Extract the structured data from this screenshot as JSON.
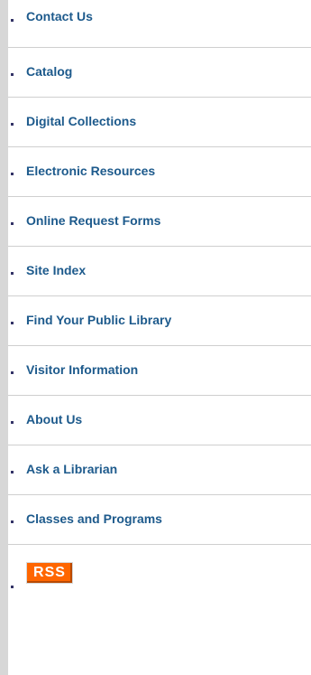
{
  "nav": {
    "items": [
      {
        "label": "Contact Us"
      },
      {
        "label": "Catalog"
      },
      {
        "label": "Digital Collections"
      },
      {
        "label": "Electronic Resources"
      },
      {
        "label": "Online Request Forms"
      },
      {
        "label": "Site Index"
      },
      {
        "label": "Find Your Public Library"
      },
      {
        "label": "Visitor Information"
      },
      {
        "label": "About Us"
      },
      {
        "label": "Ask a Librarian"
      },
      {
        "label": "Classes and Programs"
      }
    ],
    "rss": {
      "label": "RSS"
    }
  },
  "colors": {
    "link": "#1d5a8c",
    "rss": "#ff6600",
    "rule": "#d7d7d7"
  }
}
